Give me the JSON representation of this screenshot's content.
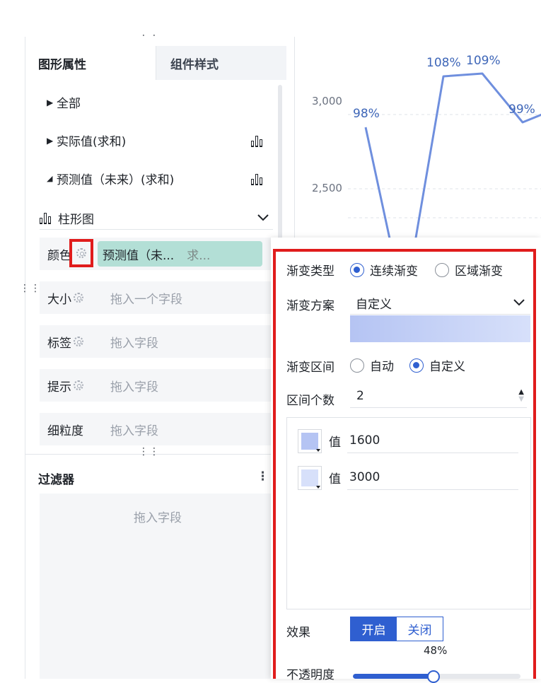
{
  "left": {
    "tabs": {
      "graphic": "图形属性",
      "component": "组件样式"
    },
    "tree": {
      "all": "全部",
      "actual": "实际值(求和)",
      "forecast": "预测值（未来）(求和)"
    },
    "marker": {
      "type": "柱形图"
    },
    "fields": {
      "color": {
        "label": "颜色",
        "value": "预测值（未...",
        "aggregation": "求..."
      },
      "size": {
        "label": "大小",
        "placeholder": "拖入一个字段"
      },
      "tag": {
        "label": "标签",
        "placeholder": "拖入字段"
      },
      "tip": {
        "label": "提示",
        "placeholder": "拖入字段"
      },
      "granularity": {
        "label": "细粒度",
        "placeholder": "拖入字段"
      }
    },
    "filter": {
      "title": "过滤器",
      "placeholder": "拖入字段"
    }
  },
  "chart": {
    "y_ticks": [
      "3,000",
      "2,500"
    ],
    "labels": [
      "98%",
      "108%",
      "109%",
      "99%"
    ]
  },
  "chart_data": {
    "type": "line",
    "y_ticks": [
      2500,
      3000
    ],
    "point_labels": [
      "98%",
      "108%",
      "109%",
      "99%"
    ],
    "line_color": "#6f8fde"
  },
  "popup": {
    "gradient_type": {
      "label": "渐变类型",
      "options": [
        "连续渐变",
        "区域渐变"
      ],
      "selected": "连续渐变"
    },
    "gradient_scheme": {
      "label": "渐变方案",
      "value": "自定义"
    },
    "gradient_range": {
      "label": "渐变区间",
      "options": [
        "自动",
        "自定义"
      ],
      "selected": "自定义"
    },
    "interval_count": {
      "label": "区间个数",
      "value": "2"
    },
    "stops": [
      {
        "label": "值",
        "value": "1600",
        "color": "#b5c4f3"
      },
      {
        "label": "值",
        "value": "3000",
        "color": "#d7e0fa"
      }
    ],
    "effect": {
      "label": "效果",
      "on": "开启",
      "off": "关闭",
      "active": "开启"
    },
    "opacity": {
      "label": "不透明度",
      "value_text": "48%",
      "value": 48
    },
    "colors": {
      "accent": "#2f5fd0",
      "highlight_border": "#e01c1c"
    }
  }
}
